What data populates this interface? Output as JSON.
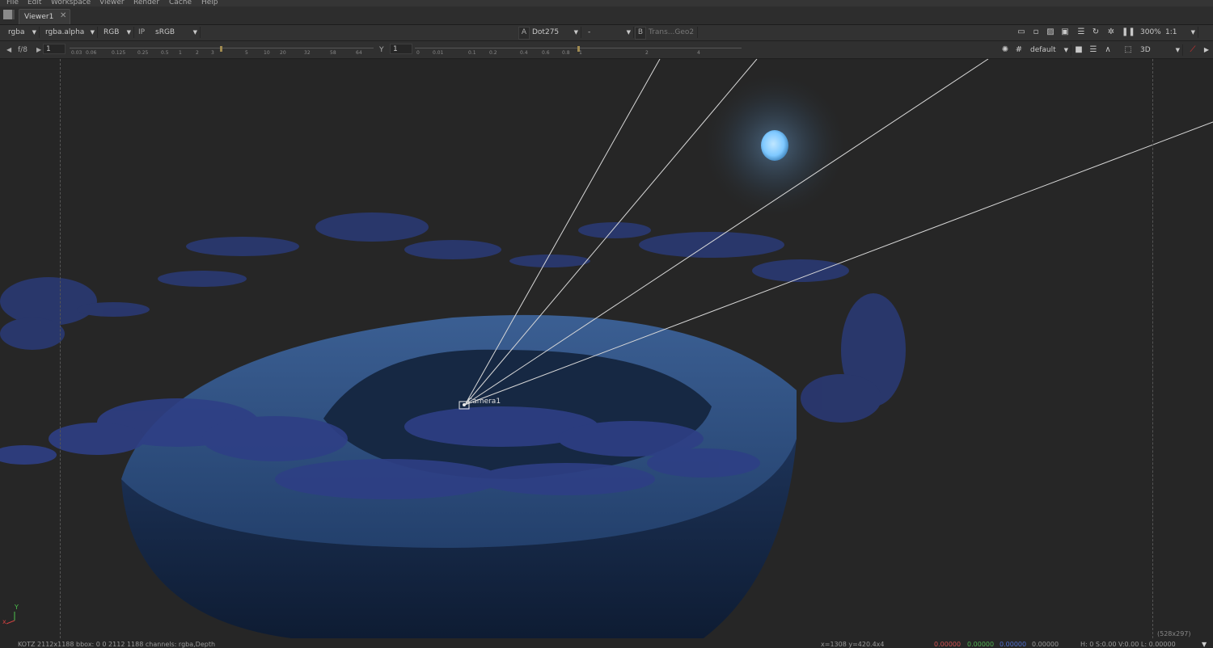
{
  "menubar": [
    "File",
    "Edit",
    "Workspace",
    "Viewer",
    "Render",
    "Cache",
    "Help"
  ],
  "tab": {
    "label": "Viewer1",
    "close": "✕"
  },
  "toolbar1": {
    "channels": "rgba",
    "alpha": "rgba.alpha",
    "display": "RGB",
    "ip": "IP",
    "lut": "sRGB",
    "a_label": "A",
    "a_input": "Dot275",
    "wipe": "-",
    "b_label": "B",
    "b_input": "Trans...Geo2",
    "zoom": "300%",
    "ratio": "1:1"
  },
  "toolbar2": {
    "fstop": "f/8",
    "gain_value": "1",
    "gain_ticks": [
      "0.03",
      "0.06",
      "0.125",
      "0.25",
      "0.5",
      "1",
      "2",
      "3",
      "5",
      "10",
      "20",
      "32",
      "58",
      "64"
    ],
    "gamma_label": "Y",
    "gamma_value": "1",
    "gamma_ticks": [
      "0",
      "0.01",
      "0.1",
      "0.2",
      "0.4",
      "0.6",
      "0.8",
      "1",
      "2",
      "4"
    ],
    "grid_symbol": "#",
    "overlay": "default",
    "view_mode": "3D"
  },
  "viewer": {
    "camera_label": "Camera1",
    "resolution": "(528x297)",
    "axis_y": "Y",
    "axis_x": "x"
  },
  "status": {
    "format": "KOTZ 2112x1188  bbox: 0 0 2112 1188 channels: rgba,Depth",
    "coords": "x=1308 y=420.4x4",
    "r": "0.00000",
    "g": "0.00000",
    "b": "0.00000",
    "a": "0.00000",
    "hsv": "H:  0 S:0.00 V:0.00  L: 0.00000"
  },
  "colors": {
    "r": "#d05050",
    "g": "#50b050",
    "b": "#5070d0",
    "moon": "#7ec8ff"
  }
}
